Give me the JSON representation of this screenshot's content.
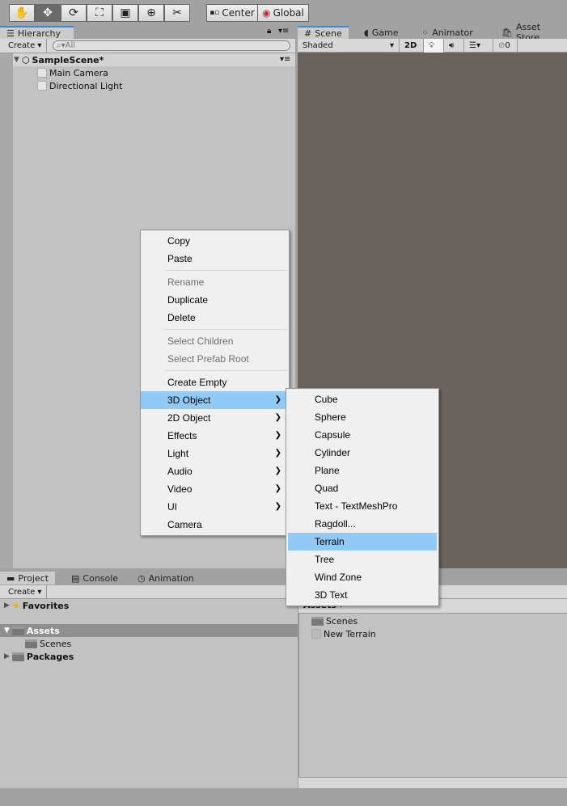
{
  "toolbar": {
    "tools": [
      {
        "icon": "hand-icon",
        "glyph": "✋"
      },
      {
        "icon": "move-icon",
        "glyph": "✥"
      },
      {
        "icon": "rotate-icon",
        "glyph": "⟳"
      },
      {
        "icon": "scale-icon",
        "glyph": "⛶"
      },
      {
        "icon": "rect-icon",
        "glyph": "▣"
      },
      {
        "icon": "transform-icon",
        "glyph": "⊕"
      },
      {
        "icon": "custom-tool-icon",
        "glyph": "✂"
      }
    ],
    "pivot": "Center",
    "space": "Global"
  },
  "hierarchy": {
    "tab": "Hierarchy",
    "create": "Create",
    "search_placeholder": "All",
    "scene": "SampleScene*",
    "items": [
      "Main Camera",
      "Directional Light"
    ]
  },
  "scene": {
    "tabs": [
      "Scene",
      "Game",
      "Animator",
      "Asset Store"
    ],
    "shading": "Shaded",
    "mode2d": "2D",
    "hidden_count": "0",
    "viewport_color": "#6a625c"
  },
  "context_menu": {
    "groups": [
      [
        {
          "label": "Copy",
          "enabled": true
        },
        {
          "label": "Paste",
          "enabled": true
        }
      ],
      [
        {
          "label": "Rename",
          "enabled": false
        },
        {
          "label": "Duplicate",
          "enabled": true
        },
        {
          "label": "Delete",
          "enabled": true
        }
      ],
      [
        {
          "label": "Select Children",
          "enabled": false
        },
        {
          "label": "Select Prefab Root",
          "enabled": false
        }
      ],
      [
        {
          "label": "Create Empty",
          "enabled": true
        },
        {
          "label": "3D Object",
          "submenu": true,
          "highlighted": true
        },
        {
          "label": "2D Object",
          "submenu": true
        },
        {
          "label": "Effects",
          "submenu": true
        },
        {
          "label": "Light",
          "submenu": true
        },
        {
          "label": "Audio",
          "submenu": true
        },
        {
          "label": "Video",
          "submenu": true
        },
        {
          "label": "UI",
          "submenu": true
        },
        {
          "label": "Camera",
          "enabled": true
        }
      ]
    ],
    "submenu": [
      "Cube",
      "Sphere",
      "Capsule",
      "Cylinder",
      "Plane",
      "Quad",
      "Text - TextMeshPro",
      "Ragdoll...",
      "Terrain",
      "Tree",
      "Wind Zone",
      "3D Text"
    ],
    "submenu_highlighted": "Terrain",
    "highlight_color": "#91c9f7"
  },
  "project": {
    "tabs": [
      "Project",
      "Console",
      "Animation"
    ],
    "create": "Create",
    "tree": {
      "favorites": "Favorites",
      "assets": "Assets",
      "scenes": "Scenes",
      "packages": "Packages"
    },
    "breadcrumb": "Assets",
    "files": [
      "Scenes",
      "New Terrain"
    ]
  }
}
